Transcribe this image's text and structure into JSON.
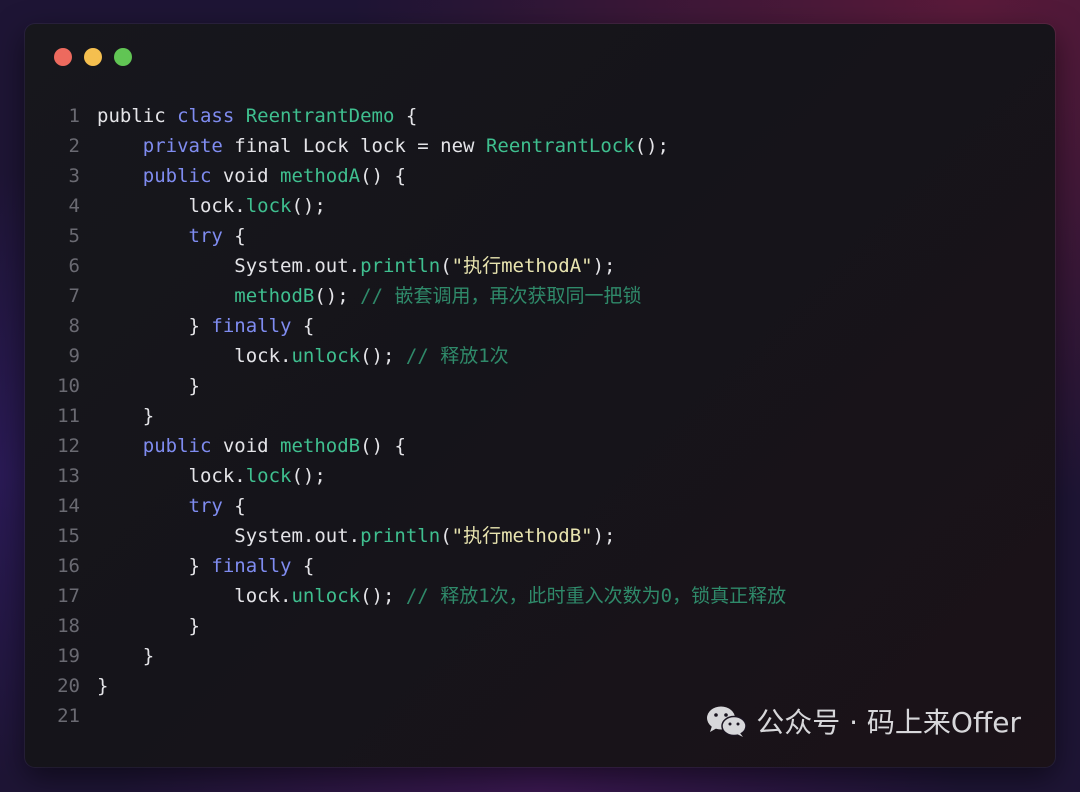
{
  "window": {
    "traffic_lights": {
      "close_color": "#ed6a5e",
      "minimize_color": "#f5bf4f",
      "maximize_color": "#61c554"
    }
  },
  "colors": {
    "keyword": "#7f8cf0",
    "type_and_method": "#3fbf8f",
    "string": "#e8e4b0",
    "comment": "#2f8a6a",
    "plain": "#e4e4e8",
    "line_number": "#6a6a72"
  },
  "code": {
    "lines": [
      {
        "num": "1",
        "segments": [
          {
            "t": "public ",
            "k": "plain"
          },
          {
            "t": "class ",
            "k": "kw"
          },
          {
            "t": "ReentrantDemo",
            "k": "cls"
          },
          {
            "t": " {",
            "k": "plain"
          }
        ]
      },
      {
        "num": "2",
        "segments": [
          {
            "t": "    ",
            "k": "plain"
          },
          {
            "t": "private",
            "k": "kw"
          },
          {
            "t": " final Lock lock = new ",
            "k": "plain"
          },
          {
            "t": "ReentrantLock",
            "k": "cls"
          },
          {
            "t": "();",
            "k": "plain"
          }
        ]
      },
      {
        "num": "3",
        "segments": [
          {
            "t": "    ",
            "k": "plain"
          },
          {
            "t": "public",
            "k": "kw"
          },
          {
            "t": " void ",
            "k": "plain"
          },
          {
            "t": "methodA",
            "k": "fn"
          },
          {
            "t": "() {",
            "k": "plain"
          }
        ]
      },
      {
        "num": "4",
        "segments": [
          {
            "t": "        lock.",
            "k": "plain"
          },
          {
            "t": "lock",
            "k": "fn"
          },
          {
            "t": "();",
            "k": "plain"
          }
        ]
      },
      {
        "num": "5",
        "segments": [
          {
            "t": "        ",
            "k": "plain"
          },
          {
            "t": "try",
            "k": "kw"
          },
          {
            "t": " {",
            "k": "plain"
          }
        ]
      },
      {
        "num": "6",
        "segments": [
          {
            "t": "            System.out.",
            "k": "plain"
          },
          {
            "t": "println",
            "k": "fn"
          },
          {
            "t": "(",
            "k": "plain"
          },
          {
            "t": "\"执行methodA\"",
            "k": "str"
          },
          {
            "t": ");",
            "k": "plain"
          }
        ]
      },
      {
        "num": "7",
        "segments": [
          {
            "t": "            ",
            "k": "plain"
          },
          {
            "t": "methodB",
            "k": "fn"
          },
          {
            "t": "(); ",
            "k": "plain"
          },
          {
            "t": "// 嵌套调用，再次获取同一把锁",
            "k": "cm"
          }
        ]
      },
      {
        "num": "8",
        "segments": [
          {
            "t": "        } ",
            "k": "plain"
          },
          {
            "t": "finally",
            "k": "kw"
          },
          {
            "t": " {",
            "k": "plain"
          }
        ]
      },
      {
        "num": "9",
        "segments": [
          {
            "t": "            lock.",
            "k": "plain"
          },
          {
            "t": "unlock",
            "k": "fn"
          },
          {
            "t": "(); ",
            "k": "plain"
          },
          {
            "t": "// 释放1次",
            "k": "cm"
          }
        ]
      },
      {
        "num": "10",
        "segments": [
          {
            "t": "        }",
            "k": "plain"
          }
        ]
      },
      {
        "num": "11",
        "segments": [
          {
            "t": "    }",
            "k": "plain"
          }
        ]
      },
      {
        "num": "12",
        "segments": [
          {
            "t": "    ",
            "k": "plain"
          },
          {
            "t": "public",
            "k": "kw"
          },
          {
            "t": " void ",
            "k": "plain"
          },
          {
            "t": "methodB",
            "k": "fn"
          },
          {
            "t": "() {",
            "k": "plain"
          }
        ]
      },
      {
        "num": "13",
        "segments": [
          {
            "t": "        lock.",
            "k": "plain"
          },
          {
            "t": "lock",
            "k": "fn"
          },
          {
            "t": "();",
            "k": "plain"
          }
        ]
      },
      {
        "num": "14",
        "segments": [
          {
            "t": "        ",
            "k": "plain"
          },
          {
            "t": "try",
            "k": "kw"
          },
          {
            "t": " {",
            "k": "plain"
          }
        ]
      },
      {
        "num": "15",
        "segments": [
          {
            "t": "            System.out.",
            "k": "plain"
          },
          {
            "t": "println",
            "k": "fn"
          },
          {
            "t": "(",
            "k": "plain"
          },
          {
            "t": "\"执行methodB\"",
            "k": "str"
          },
          {
            "t": ");",
            "k": "plain"
          }
        ]
      },
      {
        "num": "16",
        "segments": [
          {
            "t": "        } ",
            "k": "plain"
          },
          {
            "t": "finally",
            "k": "kw"
          },
          {
            "t": " {",
            "k": "plain"
          }
        ]
      },
      {
        "num": "17",
        "segments": [
          {
            "t": "            lock.",
            "k": "plain"
          },
          {
            "t": "unlock",
            "k": "fn"
          },
          {
            "t": "(); ",
            "k": "plain"
          },
          {
            "t": "// 释放1次，此时重入次数为0，锁真正释放",
            "k": "cm"
          }
        ]
      },
      {
        "num": "18",
        "segments": [
          {
            "t": "        }",
            "k": "plain"
          }
        ]
      },
      {
        "num": "19",
        "segments": [
          {
            "t": "    }",
            "k": "plain"
          }
        ]
      },
      {
        "num": "20",
        "segments": [
          {
            "t": "}",
            "k": "plain"
          }
        ]
      },
      {
        "num": "21",
        "segments": []
      }
    ]
  },
  "watermark": {
    "icon": "wechat-icon",
    "text": "公众号 · 码上来Offer"
  }
}
